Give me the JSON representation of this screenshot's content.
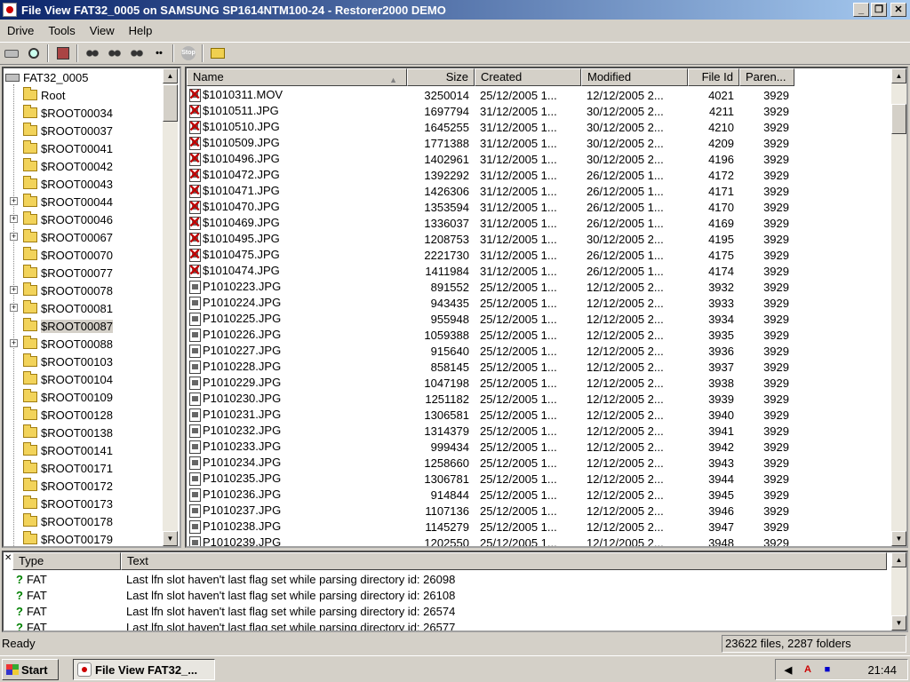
{
  "window": {
    "title": "File View FAT32_0005 on SAMSUNG SP1614NTM100-24 - Restorer2000 DEMO",
    "minimize": "_",
    "restore": "❐",
    "close": "✕"
  },
  "menu": [
    "Drive",
    "Tools",
    "View",
    "Help"
  ],
  "toolbar": {
    "stop_label": "Stop",
    "dots_label": "••"
  },
  "tree": {
    "root": "FAT32_0005",
    "items": [
      {
        "label": "Root",
        "expandable": false
      },
      {
        "label": "$ROOT00034",
        "expandable": false
      },
      {
        "label": "$ROOT00037",
        "expandable": false
      },
      {
        "label": "$ROOT00041",
        "expandable": false
      },
      {
        "label": "$ROOT00042",
        "expandable": false
      },
      {
        "label": "$ROOT00043",
        "expandable": false
      },
      {
        "label": "$ROOT00044",
        "expandable": true
      },
      {
        "label": "$ROOT00046",
        "expandable": true
      },
      {
        "label": "$ROOT00067",
        "expandable": true
      },
      {
        "label": "$ROOT00070",
        "expandable": false
      },
      {
        "label": "$ROOT00077",
        "expandable": false
      },
      {
        "label": "$ROOT00078",
        "expandable": true
      },
      {
        "label": "$ROOT00081",
        "expandable": true
      },
      {
        "label": "$ROOT00087",
        "expandable": false,
        "selected": true
      },
      {
        "label": "$ROOT00088",
        "expandable": true
      },
      {
        "label": "$ROOT00103",
        "expandable": false
      },
      {
        "label": "$ROOT00104",
        "expandable": false
      },
      {
        "label": "$ROOT00109",
        "expandable": false
      },
      {
        "label": "$ROOT00128",
        "expandable": false
      },
      {
        "label": "$ROOT00138",
        "expandable": false
      },
      {
        "label": "$ROOT00141",
        "expandable": false
      },
      {
        "label": "$ROOT00171",
        "expandable": false
      },
      {
        "label": "$ROOT00172",
        "expandable": false
      },
      {
        "label": "$ROOT00173",
        "expandable": false
      },
      {
        "label": "$ROOT00178",
        "expandable": false
      },
      {
        "label": "$ROOT00179",
        "expandable": false
      }
    ]
  },
  "file_list": {
    "columns": [
      "Name",
      "Size",
      "Created",
      "Modified",
      "File Id",
      "Paren..."
    ],
    "rows": [
      {
        "deleted": true,
        "name": "$1010311.MOV",
        "size": "3250014",
        "created": "25/12/2005 1...",
        "modified": "12/12/2005 2...",
        "file_id": "4021",
        "parent": "3929"
      },
      {
        "deleted": true,
        "name": "$1010511.JPG",
        "size": "1697794",
        "created": "31/12/2005 1...",
        "modified": "30/12/2005 2...",
        "file_id": "4211",
        "parent": "3929"
      },
      {
        "deleted": true,
        "name": "$1010510.JPG",
        "size": "1645255",
        "created": "31/12/2005 1...",
        "modified": "30/12/2005 2...",
        "file_id": "4210",
        "parent": "3929"
      },
      {
        "deleted": true,
        "name": "$1010509.JPG",
        "size": "1771388",
        "created": "31/12/2005 1...",
        "modified": "30/12/2005 2...",
        "file_id": "4209",
        "parent": "3929"
      },
      {
        "deleted": true,
        "name": "$1010496.JPG",
        "size": "1402961",
        "created": "31/12/2005 1...",
        "modified": "30/12/2005 2...",
        "file_id": "4196",
        "parent": "3929"
      },
      {
        "deleted": true,
        "name": "$1010472.JPG",
        "size": "1392292",
        "created": "31/12/2005 1...",
        "modified": "26/12/2005 1...",
        "file_id": "4172",
        "parent": "3929"
      },
      {
        "deleted": true,
        "name": "$1010471.JPG",
        "size": "1426306",
        "created": "31/12/2005 1...",
        "modified": "26/12/2005 1...",
        "file_id": "4171",
        "parent": "3929"
      },
      {
        "deleted": true,
        "name": "$1010470.JPG",
        "size": "1353594",
        "created": "31/12/2005 1...",
        "modified": "26/12/2005 1...",
        "file_id": "4170",
        "parent": "3929"
      },
      {
        "deleted": true,
        "name": "$1010469.JPG",
        "size": "1336037",
        "created": "31/12/2005 1...",
        "modified": "26/12/2005 1...",
        "file_id": "4169",
        "parent": "3929"
      },
      {
        "deleted": true,
        "name": "$1010495.JPG",
        "size": "1208753",
        "created": "31/12/2005 1...",
        "modified": "30/12/2005 2...",
        "file_id": "4195",
        "parent": "3929"
      },
      {
        "deleted": true,
        "name": "$1010475.JPG",
        "size": "2221730",
        "created": "31/12/2005 1...",
        "modified": "26/12/2005 1...",
        "file_id": "4175",
        "parent": "3929"
      },
      {
        "deleted": true,
        "name": "$1010474.JPG",
        "size": "1411984",
        "created": "31/12/2005 1...",
        "modified": "26/12/2005 1...",
        "file_id": "4174",
        "parent": "3929"
      },
      {
        "deleted": false,
        "name": "P1010223.JPG",
        "size": "891552",
        "created": "25/12/2005 1...",
        "modified": "12/12/2005 2...",
        "file_id": "3932",
        "parent": "3929"
      },
      {
        "deleted": false,
        "name": "P1010224.JPG",
        "size": "943435",
        "created": "25/12/2005 1...",
        "modified": "12/12/2005 2...",
        "file_id": "3933",
        "parent": "3929"
      },
      {
        "deleted": false,
        "name": "P1010225.JPG",
        "size": "955948",
        "created": "25/12/2005 1...",
        "modified": "12/12/2005 2...",
        "file_id": "3934",
        "parent": "3929"
      },
      {
        "deleted": false,
        "name": "P1010226.JPG",
        "size": "1059388",
        "created": "25/12/2005 1...",
        "modified": "12/12/2005 2...",
        "file_id": "3935",
        "parent": "3929"
      },
      {
        "deleted": false,
        "name": "P1010227.JPG",
        "size": "915640",
        "created": "25/12/2005 1...",
        "modified": "12/12/2005 2...",
        "file_id": "3936",
        "parent": "3929"
      },
      {
        "deleted": false,
        "name": "P1010228.JPG",
        "size": "858145",
        "created": "25/12/2005 1...",
        "modified": "12/12/2005 2...",
        "file_id": "3937",
        "parent": "3929"
      },
      {
        "deleted": false,
        "name": "P1010229.JPG",
        "size": "1047198",
        "created": "25/12/2005 1...",
        "modified": "12/12/2005 2...",
        "file_id": "3938",
        "parent": "3929"
      },
      {
        "deleted": false,
        "name": "P1010230.JPG",
        "size": "1251182",
        "created": "25/12/2005 1...",
        "modified": "12/12/2005 2...",
        "file_id": "3939",
        "parent": "3929"
      },
      {
        "deleted": false,
        "name": "P1010231.JPG",
        "size": "1306581",
        "created": "25/12/2005 1...",
        "modified": "12/12/2005 2...",
        "file_id": "3940",
        "parent": "3929"
      },
      {
        "deleted": false,
        "name": "P1010232.JPG",
        "size": "1314379",
        "created": "25/12/2005 1...",
        "modified": "12/12/2005 2...",
        "file_id": "3941",
        "parent": "3929"
      },
      {
        "deleted": false,
        "name": "P1010233.JPG",
        "size": "999434",
        "created": "25/12/2005 1...",
        "modified": "12/12/2005 2...",
        "file_id": "3942",
        "parent": "3929"
      },
      {
        "deleted": false,
        "name": "P1010234.JPG",
        "size": "1258660",
        "created": "25/12/2005 1...",
        "modified": "12/12/2005 2...",
        "file_id": "3943",
        "parent": "3929"
      },
      {
        "deleted": false,
        "name": "P1010235.JPG",
        "size": "1306781",
        "created": "25/12/2005 1...",
        "modified": "12/12/2005 2...",
        "file_id": "3944",
        "parent": "3929"
      },
      {
        "deleted": false,
        "name": "P1010236.JPG",
        "size": "914844",
        "created": "25/12/2005 1...",
        "modified": "12/12/2005 2...",
        "file_id": "3945",
        "parent": "3929"
      },
      {
        "deleted": false,
        "name": "P1010237.JPG",
        "size": "1107136",
        "created": "25/12/2005 1...",
        "modified": "12/12/2005 2...",
        "file_id": "3946",
        "parent": "3929"
      },
      {
        "deleted": false,
        "name": "P1010238.JPG",
        "size": "1145279",
        "created": "25/12/2005 1...",
        "modified": "12/12/2005 2...",
        "file_id": "3947",
        "parent": "3929"
      },
      {
        "deleted": false,
        "name": "P1010239.JPG",
        "size": "1202550",
        "created": "25/12/2005 1...",
        "modified": "12/12/2005 2...",
        "file_id": "3948",
        "parent": "3929"
      }
    ]
  },
  "log": {
    "columns": [
      "Type",
      "Text"
    ],
    "rows": [
      {
        "type": "FAT",
        "text": "Last lfn slot haven't last flag set while parsing directory id: 26098"
      },
      {
        "type": "FAT",
        "text": "Last lfn slot haven't last flag set while parsing directory id: 26108"
      },
      {
        "type": "FAT",
        "text": "Last lfn slot haven't last flag set while parsing directory id: 26574"
      },
      {
        "type": "FAT",
        "text": "Last lfn slot haven't last flag set while parsing directory id: 26577"
      }
    ]
  },
  "status": {
    "left": "Ready",
    "right": "23622 files, 2287 folders"
  },
  "taskbar": {
    "start": "Start",
    "task": "File View FAT32_...",
    "clock": "21:44"
  }
}
